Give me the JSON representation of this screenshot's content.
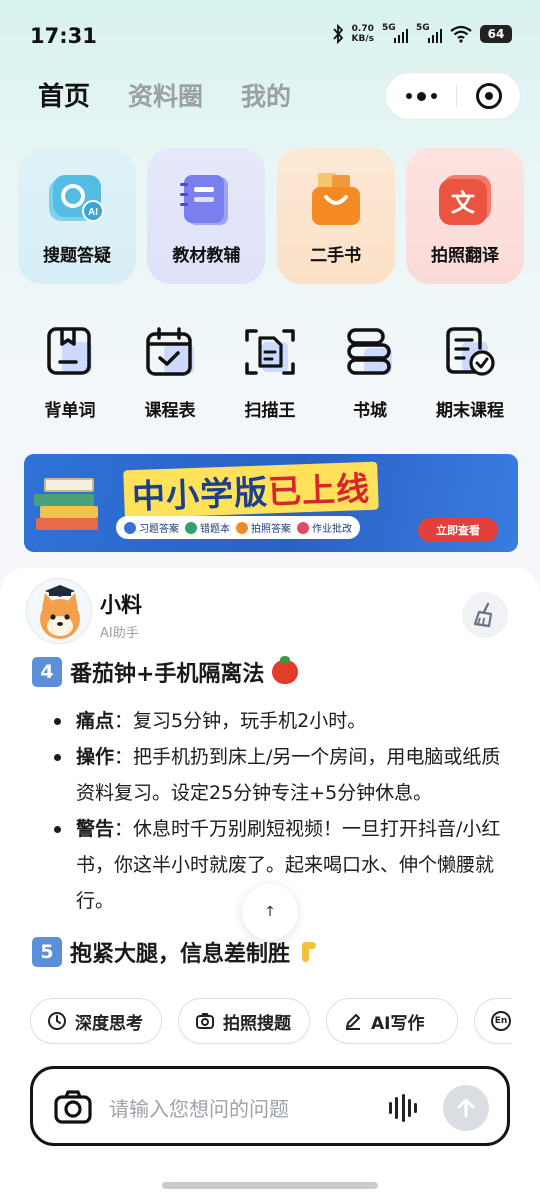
{
  "status": {
    "time": "17:31",
    "speed_value": "0.70",
    "speed_unit": "KB/s",
    "sim1": "5G",
    "sim2": "5G",
    "battery": "64"
  },
  "nav": {
    "tabs": [
      "首页",
      "资料圈",
      "我的"
    ],
    "active": "首页"
  },
  "cards": [
    {
      "label": "搜题答疑",
      "icon": "ai-search-icon",
      "color": "#4bb8e0"
    },
    {
      "label": "教材教辅",
      "icon": "notebook-icon",
      "color": "#7a7ff0"
    },
    {
      "label": "二手书",
      "icon": "shopping-bag-icon",
      "color": "#f28a2c"
    },
    {
      "label": "拍照翻译",
      "icon": "translate-icon",
      "color": "#ee5a4a"
    }
  ],
  "tools": [
    {
      "label": "背单词",
      "icon": "bookmark-book-icon"
    },
    {
      "label": "课程表",
      "icon": "calendar-check-icon"
    },
    {
      "label": "扫描王",
      "icon": "scan-document-icon"
    },
    {
      "label": "书城",
      "icon": "book-stack-icon"
    },
    {
      "label": "期末课程",
      "icon": "checklist-icon"
    }
  ],
  "banner": {
    "title_main": "中小学版",
    "title_highlight": "已上线",
    "pills": [
      "习题答案",
      "错题本",
      "拍照答案",
      "作业批改"
    ],
    "cta": "立即查看"
  },
  "bot": {
    "name": "小料",
    "role": "AI助手"
  },
  "message": {
    "section4_num": "4",
    "section4_title": "番茄钟+手机隔离法",
    "bullets": [
      {
        "key": "痛点",
        "text": "：复习5分钟，玩手机2小时。"
      },
      {
        "key": "操作",
        "text": "：把手机扔到床上/另一个房间，用电脑或纸质资料复习。设定25分钟专注+5分钟休息。"
      },
      {
        "key": "警告",
        "text": "：休息时千万别刷短视频！一旦打开抖音/小红书，你这半小时就废了。起来喝口水、伸个懒腰就行。"
      }
    ],
    "section5_num": "5",
    "section5_title": "抱紧大腿，信息差制胜"
  },
  "scroll_top_glyph": "↑",
  "chips": [
    {
      "label": "深度思考",
      "icon": "clock-icon"
    },
    {
      "label": "拍照搜题",
      "icon": "camera-icon"
    },
    {
      "label": "AI写作",
      "icon": "pen-icon"
    },
    {
      "label": "En",
      "icon": "english-icon"
    }
  ],
  "input": {
    "placeholder": "请输入您想问的问题"
  }
}
